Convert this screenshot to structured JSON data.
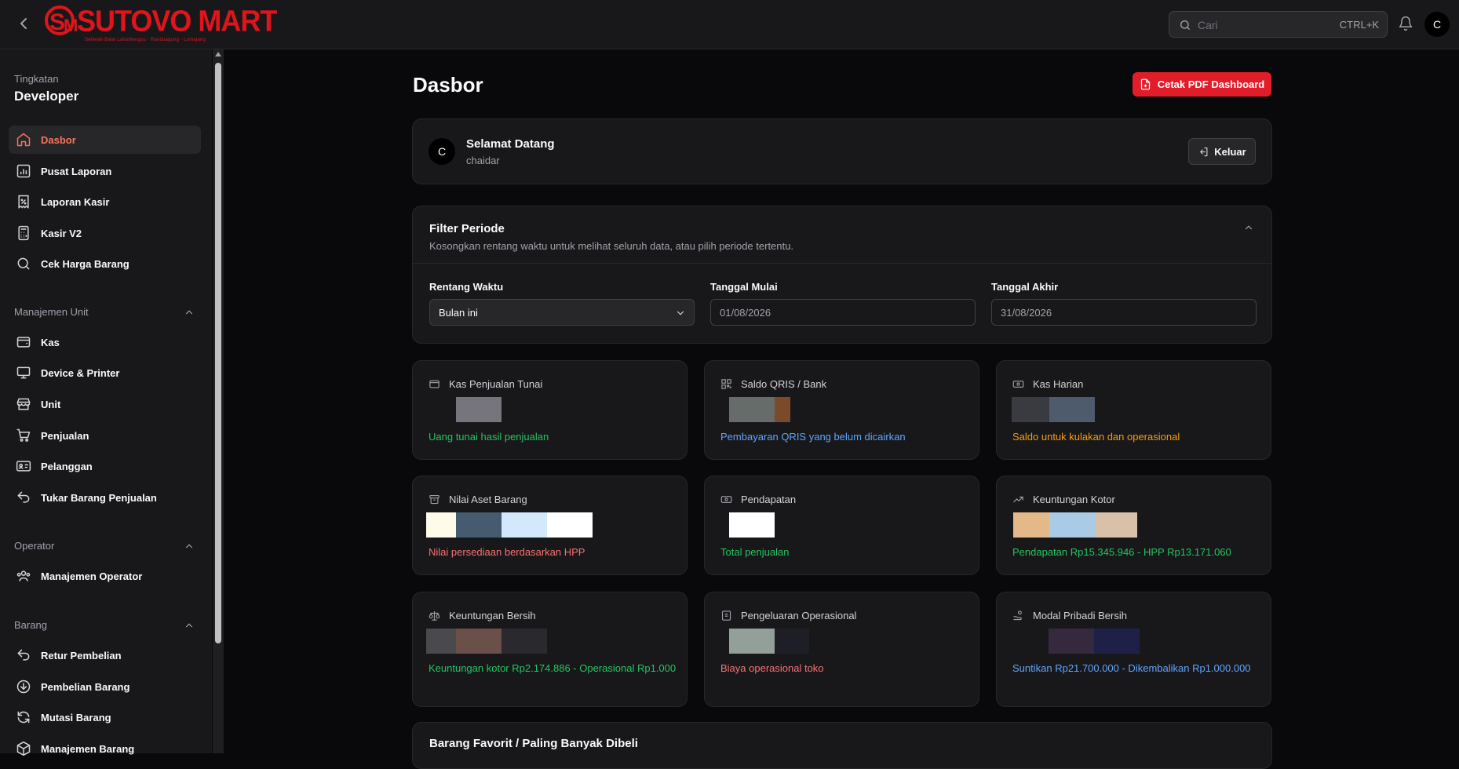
{
  "header": {
    "brand": "SUTOVO MART",
    "brand_sub": "Sebelah Balai Latioblengsu · Randuagung · Lumajang",
    "search_placeholder": "Cari",
    "search_shortcut": "CTRL+K",
    "avatar_initial": "C"
  },
  "sidebar": {
    "tier_label": "Tingkatan",
    "tier_value": "Developer",
    "items": [
      {
        "label": "Dasbor",
        "icon": "home-icon"
      },
      {
        "label": "Pusat Laporan",
        "icon": "bar-chart-icon"
      },
      {
        "label": "Laporan Kasir",
        "icon": "receipt-percent-icon"
      },
      {
        "label": "Kasir V2",
        "icon": "calculator-icon"
      },
      {
        "label": "Cek Harga Barang",
        "icon": "search-icon"
      }
    ],
    "sections": [
      {
        "title": "Manajemen Unit",
        "items": [
          {
            "label": "Kas",
            "icon": "wallet-icon"
          },
          {
            "label": "Device & Printer",
            "icon": "monitor-icon"
          },
          {
            "label": "Unit",
            "icon": "store-icon"
          },
          {
            "label": "Penjualan",
            "icon": "cart-icon"
          },
          {
            "label": "Pelanggan",
            "icon": "id-card-icon"
          },
          {
            "label": "Tukar Barang Penjualan",
            "icon": "undo-icon"
          }
        ]
      },
      {
        "title": "Operator",
        "items": [
          {
            "label": "Manajemen Operator",
            "icon": "users-icon"
          }
        ]
      },
      {
        "title": "Barang",
        "items": [
          {
            "label": "Retur Pembelian",
            "icon": "undo-icon"
          },
          {
            "label": "Pembelian Barang",
            "icon": "download-circle-icon"
          },
          {
            "label": "Mutasi Barang",
            "icon": "refresh-icon"
          },
          {
            "label": "Manajemen Barang",
            "icon": "box-icon"
          }
        ]
      }
    ]
  },
  "page": {
    "title": "Dasbor",
    "pdf_button": "Cetak PDF Dashboard"
  },
  "welcome": {
    "avatar_initial": "C",
    "title": "Selamat Datang",
    "username": "chaidar",
    "logout_label": "Keluar"
  },
  "filter": {
    "title": "Filter Periode",
    "description": "Kosongkan rentang waktu untuk melihat seluruh data, atau pilih periode tertentu.",
    "range_label": "Rentang Waktu",
    "range_value": "Bulan ini",
    "start_label": "Tanggal Mulai",
    "start_value": "01/08/2026",
    "end_label": "Tanggal Akhir",
    "end_value": "31/08/2026"
  },
  "stats": [
    {
      "title": "Kas Penjualan Tunai",
      "icon": "wallet-icon",
      "desc": "Uang tunai hasil penjualan",
      "color": "#22c55e"
    },
    {
      "title": "Saldo QRIS / Bank",
      "icon": "qr-code-icon",
      "desc": "Pembayaran QRIS yang belum dicairkan",
      "color": "#60a5fa"
    },
    {
      "title": "Kas Harian",
      "icon": "banknote-icon",
      "desc": "Saldo untuk kulakan dan operasional",
      "color": "#f59e0b"
    },
    {
      "title": "Nilai Aset Barang",
      "icon": "archive-icon",
      "desc": "Nilai persediaan berdasarkan HPP",
      "color": "#f87171"
    },
    {
      "title": "Pendapatan",
      "icon": "banknote-icon",
      "desc": "Total penjualan",
      "color": "#22c55e"
    },
    {
      "title": "Keuntungan Kotor",
      "icon": "trending-up-icon",
      "desc": "Pendapatan Rp15.345.946 - HPP Rp13.171.060",
      "color": "#22c55e"
    },
    {
      "title": "Keuntungan Bersih",
      "icon": "scale-icon",
      "desc": "Keuntungan kotor Rp2.174.886 - Operasional Rp1.000",
      "color": "#22c55e"
    },
    {
      "title": "Pengeluaran Operasional",
      "icon": "receipt-icon",
      "desc": "Biaya operasional toko",
      "color": "#f87171"
    },
    {
      "title": "Modal Pribadi Bersih",
      "icon": "hand-coins-icon",
      "desc": "Suntikan Rp21.700.000 - Dikembalikan Rp1.000.000",
      "color": "#60a5fa"
    }
  ],
  "favorites": {
    "title": "Barang Favorit / Paling Banyak Dibeli"
  },
  "colors": {
    "accent": "#e11d2a",
    "active_nav": "#f9735b",
    "background": "#09090b",
    "card": "#18181b"
  }
}
